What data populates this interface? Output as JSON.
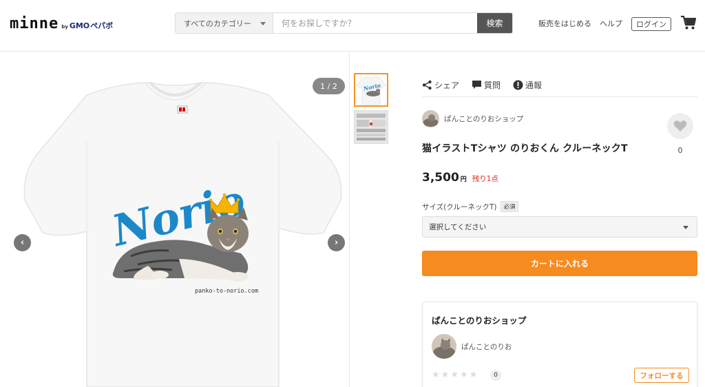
{
  "header": {
    "logo": {
      "main": "minne",
      "by": "by",
      "gmo": "GMO",
      "pepabo": "ペパボ"
    },
    "search": {
      "category": "すべてのカテゴリー",
      "placeholder": "何をお探しですか？",
      "button": "検索"
    },
    "nav": {
      "sell": "販売をはじめる",
      "help": "ヘルプ",
      "login": "ログイン"
    },
    "cart_icon": "cart-icon"
  },
  "gallery": {
    "counter": "1 / 2",
    "shirt_print": {
      "brand_text": "Norio",
      "url_text": "panko-to-norio.com"
    },
    "prev_icon": "chevron-left-icon",
    "next_icon": "chevron-right-icon"
  },
  "product": {
    "actions": [
      {
        "label": "シェア",
        "icon": "share-icon"
      },
      {
        "label": "質問",
        "icon": "chat-icon"
      },
      {
        "label": "通報",
        "icon": "alert-icon"
      }
    ],
    "shop_name": "ぱんことのりおショップ",
    "favorite_count": "0",
    "title": "猫イラストTシャツ のりおくん クルーネックT",
    "price": "3,500",
    "currency": "円",
    "stock": "残り1点",
    "size_label": "サイズ(クルーネックT)",
    "required_badge": "必須",
    "select_value": "選択してください",
    "cart_button": "カートに入れる"
  },
  "shop_card": {
    "title": "ぱんことのりおショップ",
    "owner": "ぱんことのりお",
    "rating_count": "0",
    "follow_button": "フォローする"
  },
  "colors": {
    "accent": "#f68b1f",
    "stock_red": "#d9261c",
    "logo_blue": "#1a88c9"
  }
}
